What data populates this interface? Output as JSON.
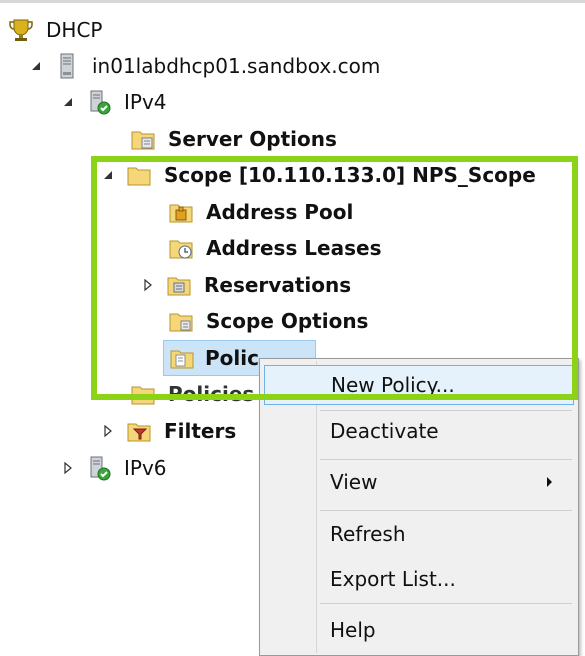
{
  "tree": {
    "dhcp": "DHCP",
    "server": "in01labdhcp01.sandbox.com",
    "ipv4": "IPv4",
    "server_options": "Server Options",
    "scope": "Scope [10.110.133.0] NPS_Scope",
    "address_pool": "Address Pool",
    "address_leases": "Address Leases",
    "reservations": "Reservations",
    "scope_options": "Scope Options",
    "policies_selected": "Polic",
    "policies_obscured": "Policies",
    "filters": "Filters",
    "ipv6": "IPv6"
  },
  "context_menu": {
    "items": [
      "New Policy...",
      "Deactivate",
      "View",
      "Refresh",
      "Export List...",
      "Help"
    ]
  },
  "colors": {
    "highlight_box": "#8cd318",
    "menu_hover": "#e5f1fb",
    "menu_hover_border": "#6fb1e8"
  }
}
